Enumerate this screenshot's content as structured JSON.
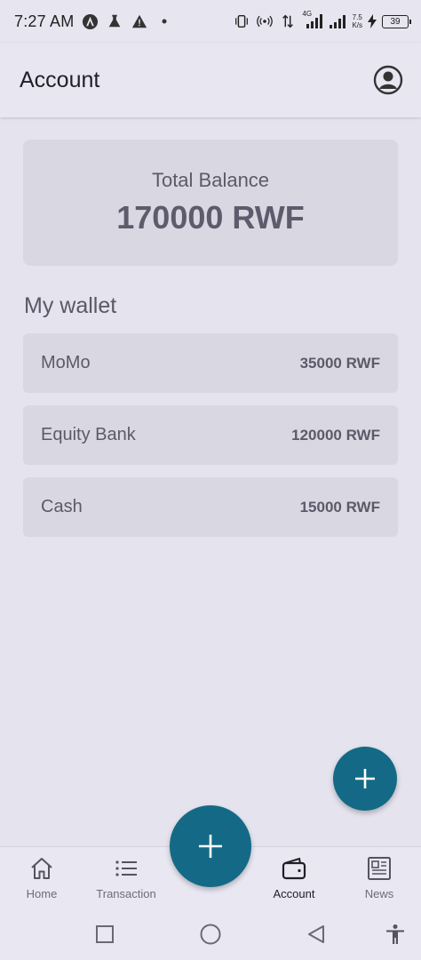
{
  "status_bar": {
    "time": "7:27 AM",
    "network_speed_value": "7.5",
    "network_speed_unit": "K/s",
    "signal_label": "4G",
    "battery": "39",
    "icons": [
      "anchor-circle-icon",
      "flask-icon",
      "warning-icon",
      "dot-icon",
      "vibrate-icon",
      "hotspot-icon",
      "data-arrows-icon",
      "signal-icon",
      "signal-2-icon",
      "charging-icon"
    ]
  },
  "header": {
    "title": "Account",
    "profile_icon": "account-circle-icon"
  },
  "balance": {
    "label": "Total Balance",
    "value": "170000 RWF"
  },
  "wallet": {
    "title": "My wallet",
    "items": [
      {
        "name": "MoMo",
        "amount": "35000 RWF"
      },
      {
        "name": "Equity Bank",
        "amount": "120000 RWF"
      },
      {
        "name": "Cash",
        "amount": "15000 RWF"
      }
    ]
  },
  "fab": {
    "icon": "plus-icon",
    "color": "#146a86"
  },
  "bottom_nav": {
    "items": [
      {
        "label": "Home",
        "icon": "home-icon"
      },
      {
        "label": "Transaction",
        "icon": "list-icon"
      },
      {
        "label": "Account",
        "icon": "wallet-icon",
        "active": true
      },
      {
        "label": "News",
        "icon": "newspaper-icon"
      }
    ]
  },
  "system_nav": {
    "icons": [
      "recents-square-icon",
      "home-circle-icon",
      "back-triangle-icon",
      "accessibility-icon"
    ]
  },
  "colors": {
    "background": "#e4e3ee",
    "card": "#d9d8e2",
    "accent": "#146a86"
  }
}
